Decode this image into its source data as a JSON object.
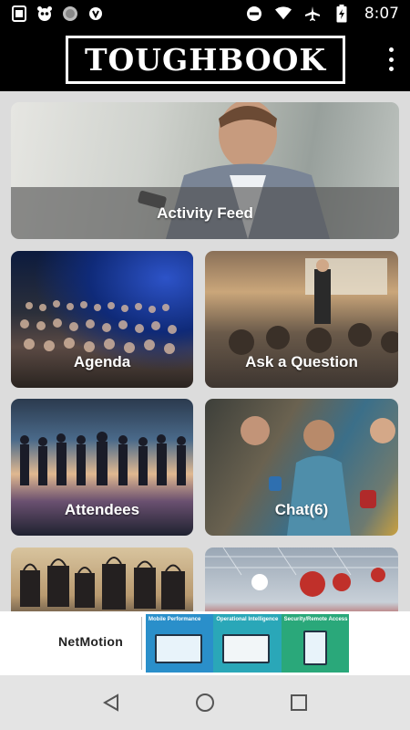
{
  "status_bar": {
    "time": "8:07",
    "left_icons": [
      "screenshot-icon",
      "panda-icon",
      "circle-icon",
      "shield-v-icon"
    ],
    "right_icons": [
      "do-not-disturb-icon",
      "wifi-icon",
      "airplane-icon",
      "battery-charging-icon"
    ]
  },
  "app_bar": {
    "logo_text": "TOUGHBOOK",
    "menu_icon": "overflow-menu-icon"
  },
  "tiles": [
    {
      "label": "Activity Feed"
    },
    {
      "label": "Agenda"
    },
    {
      "label": "Ask a Question"
    },
    {
      "label": "Attendees"
    },
    {
      "label": "Chat(6)"
    },
    {
      "label": ""
    },
    {
      "label": ""
    }
  ],
  "ad": {
    "brand": "NetMotion",
    "panels": [
      "Mobile Performance",
      "Operational Intelligence",
      "Security/Remote Access"
    ]
  },
  "nav_bar": {
    "buttons": [
      "back-icon",
      "home-icon",
      "recents-icon"
    ]
  },
  "colors": {
    "status_bg": "#000000",
    "content_bg": "#dcdcdc",
    "nav_bg": "#e4e4e4"
  }
}
